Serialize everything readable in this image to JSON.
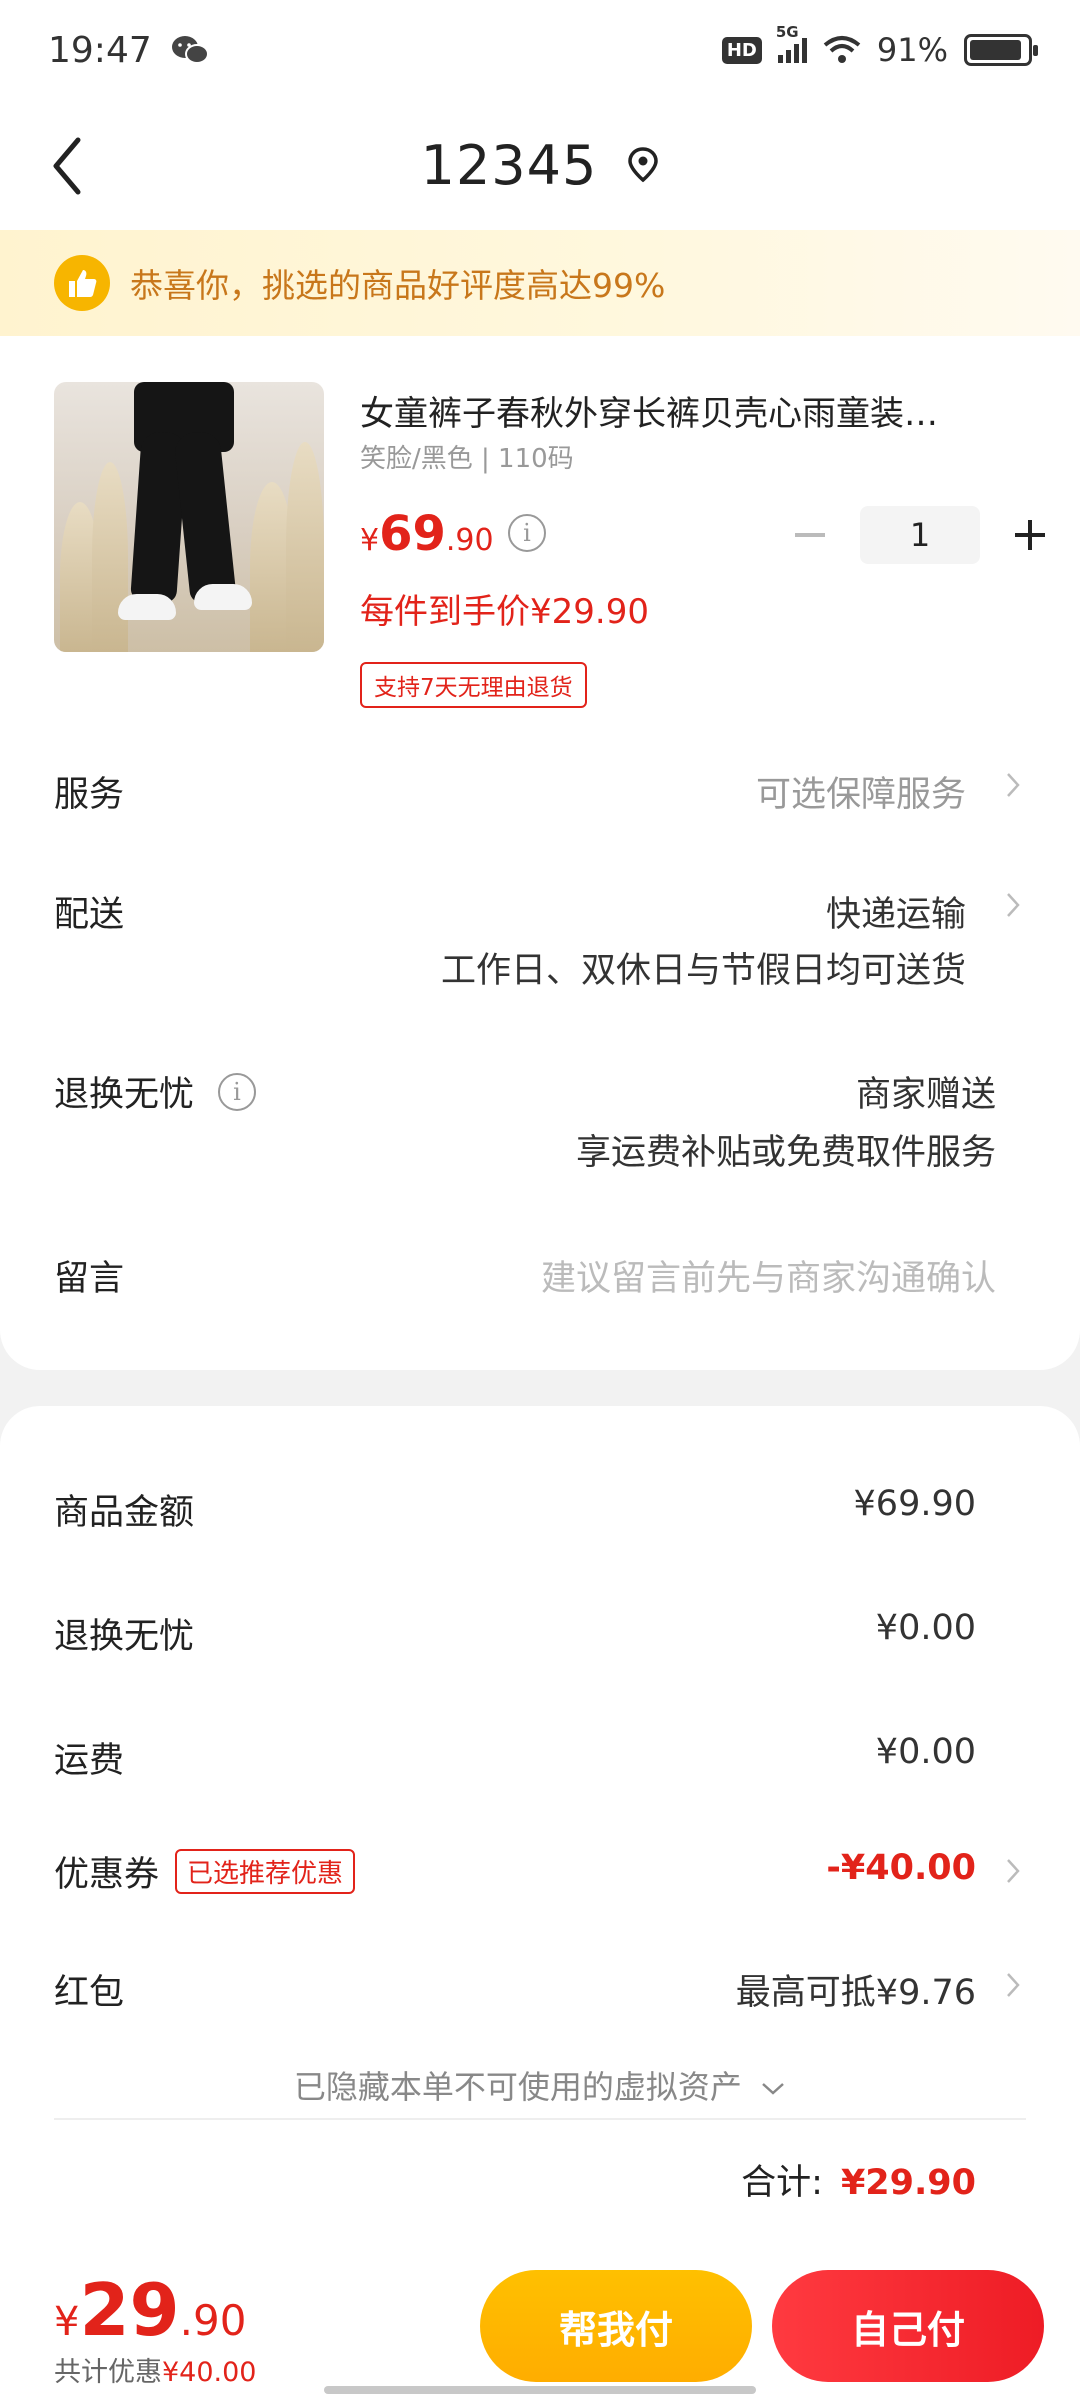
{
  "status_bar": {
    "time": "19:47",
    "hd": "HD",
    "network": "5G",
    "battery": "91%",
    "battery_level": 0.91
  },
  "header": {
    "title": "12345"
  },
  "banner": {
    "text": "恭喜你，挑选的商品好评度高达99%"
  },
  "product": {
    "title": "女童裤子春秋外穿长裤贝壳心雨童装…",
    "spec": "笑脸/黑色 | 110码",
    "price_currency": "¥",
    "price_int": "69",
    "price_dec": ".90",
    "quantity": "1",
    "unit_price": "每件到手价¥29.90",
    "return_badge": "支持7天无理由退货"
  },
  "options": {
    "service": {
      "label": "服务",
      "value": "可选保障服务"
    },
    "delivery": {
      "label": "配送",
      "value": "快递运输",
      "note": "工作日、双休日与节假日均可送货"
    },
    "worry_free": {
      "label": "退换无忧",
      "value": "商家赠送",
      "note": "享运费补贴或免费取件服务"
    },
    "message": {
      "label": "留言",
      "placeholder": "建议留言前先与商家沟通确认"
    }
  },
  "summary": {
    "goods": {
      "label": "商品金额",
      "value": "¥69.90"
    },
    "worry_free": {
      "label": "退换无忧",
      "value": "¥0.00"
    },
    "shipping": {
      "label": "运费",
      "value": "¥0.00"
    },
    "coupon": {
      "label": "优惠券",
      "badge": "已选推荐优惠",
      "value": "-¥40.00"
    },
    "red_packet": {
      "label": "红包",
      "value": "最高可抵¥9.76"
    },
    "hidden_assets": "已隐藏本单不可使用的虚拟资产",
    "total_label": "合计:",
    "total_value": "¥29.90"
  },
  "bottom_bar": {
    "currency": "¥",
    "total_int": "29",
    "total_dec": ".90",
    "discount_prefix": "共计优惠",
    "discount_value": "¥40.00",
    "help_pay": "帮我付",
    "self_pay": "自己付"
  },
  "colors": {
    "accent_red": "#e2231a",
    "accent_yellow": "#ffb800",
    "banner_text": "#c8771b"
  }
}
